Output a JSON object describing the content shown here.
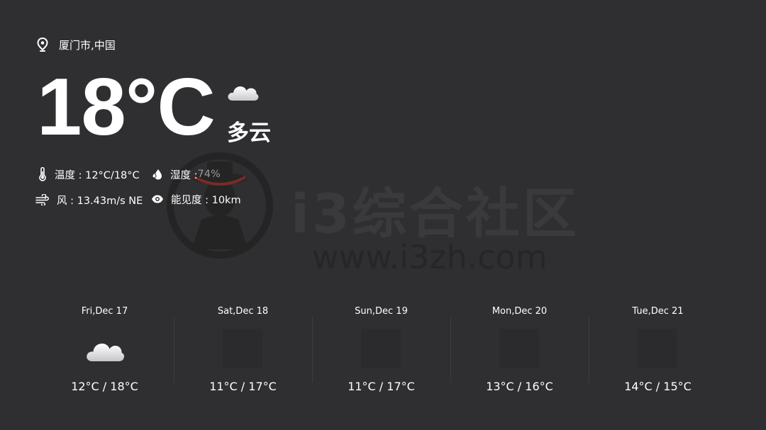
{
  "location": {
    "icon": "location-pin-icon",
    "name": "厦门市,中国"
  },
  "current": {
    "temperature": "18°C",
    "condition": "多云",
    "condition_icon": "cloud-icon"
  },
  "details": {
    "temperature": {
      "icon": "thermometer-icon",
      "label": "温度 : 12°C/18°C"
    },
    "humidity": {
      "icon": "humidity-drop-icon",
      "label": "湿度 : ",
      "value": "74%"
    },
    "wind": {
      "icon": "wind-icon",
      "label": "风 : 13.43m/s NE"
    },
    "visibility": {
      "icon": "eye-icon",
      "label": "能见度 : 10km"
    }
  },
  "forecast": [
    {
      "day": "Fri,Dec 17",
      "range": "12°C / 18°C",
      "icon": "cloud-icon"
    },
    {
      "day": "Sat,Dec 18",
      "range": "11°C / 17°C",
      "icon": ""
    },
    {
      "day": "Sun,Dec 19",
      "range": "11°C / 17°C",
      "icon": ""
    },
    {
      "day": "Mon,Dec 20",
      "range": "13°C / 16°C",
      "icon": ""
    },
    {
      "day": "Tue,Dec 21",
      "range": "14°C / 15°C",
      "icon": ""
    }
  ],
  "watermark": {
    "title": "i3综合社区",
    "url": "www.i3zh.com"
  },
  "colors": {
    "background": "#2f2f31",
    "text": "#ffffff",
    "muted": "#9a9a9c",
    "divider": "#3e3e40"
  }
}
